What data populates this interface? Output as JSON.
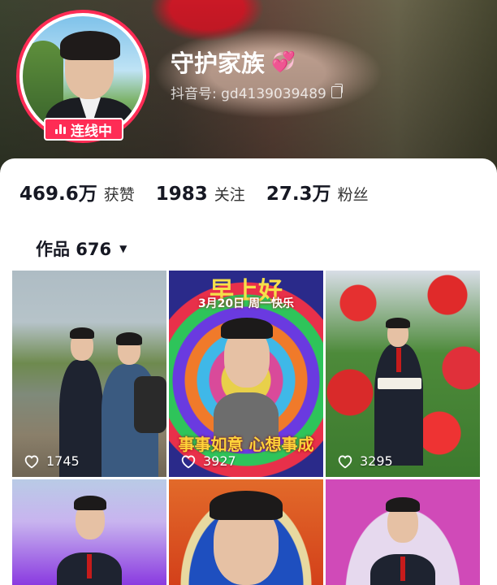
{
  "profile": {
    "nickname": "守护家族",
    "nickname_emoji": "💞",
    "douyin_id": "抖音号: gd4139039489",
    "live_badge": "连线中"
  },
  "stats": [
    {
      "value": "469.6万",
      "label": "获赞"
    },
    {
      "value": "1983",
      "label": "关注"
    },
    {
      "value": "27.3万",
      "label": "粉丝"
    }
  ],
  "works_tab": {
    "label": "作品 676"
  },
  "videos": [
    {
      "likes": "1745"
    },
    {
      "likes": "3927",
      "top_text": "早上好",
      "date_text": "3月20日 周一快乐",
      "wish_text": "事事如意 心想事成"
    },
    {
      "likes": "3295"
    },
    {
      "likes": ""
    },
    {
      "likes": ""
    },
    {
      "likes": ""
    }
  ],
  "colors": {
    "accent": "#fe2c55",
    "text": "#161823"
  },
  "icons": [
    "copy-icon",
    "heart-icon",
    "caret-down-icon",
    "live-bars-icon"
  ]
}
